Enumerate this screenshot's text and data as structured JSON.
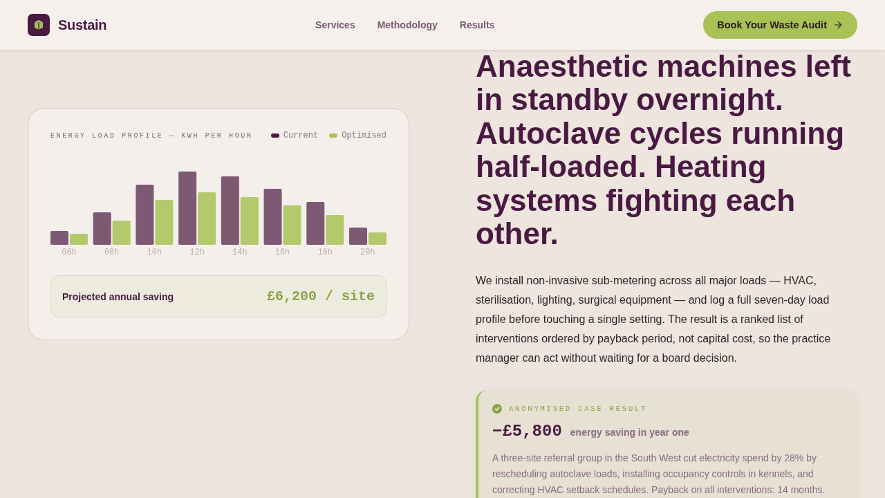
{
  "header": {
    "brand": "Sustain",
    "nav": [
      {
        "label": "Services"
      },
      {
        "label": "Methodology"
      },
      {
        "label": "Results"
      }
    ],
    "cta": "Book Your Waste Audit"
  },
  "chart_card": {
    "title": "ENERGY LOAD PROFILE — KWH PER HOUR",
    "legend": [
      {
        "label": "Current",
        "color": "#4a1942"
      },
      {
        "label": "Optimised",
        "color": "#a8c256"
      }
    ],
    "x_labels": [
      "06h",
      "08h",
      "10h",
      "12h",
      "14h",
      "16h",
      "18h",
      "20h"
    ],
    "saving": {
      "label": "Projected annual saving",
      "value": "£6,200 / site"
    }
  },
  "hero": {
    "heading": "Anaesthetic machines left in standby overnight. Autoclave cycles running half-loaded. Heating systems fighting each other.",
    "body": "We install non-invasive sub-metering across all major loads — HVAC, sterilisation, lighting, surgical equipment — and log a full seven-day load profile before touching a single setting. The result is a ranked list of interventions ordered by payback period, not capital cost, so the practice manager can act without waiting for a board decision.",
    "case": {
      "eyebrow": "ANONYMISED CASE RESULT",
      "figure": "−£5,800",
      "figure_label": "energy saving in year one",
      "text": "A three-site referral group in the South West cut electricity spend by 28% by rescheduling autoclave loads, installing occupancy controls in kennels, and correcting HVAC setback schedules. Payback on all interventions: 14 months."
    }
  }
}
